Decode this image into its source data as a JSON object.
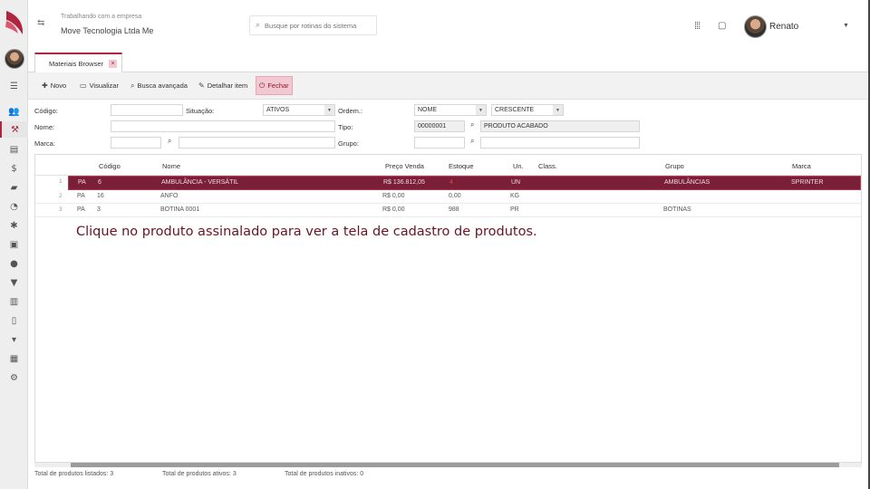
{
  "topbar": {
    "working_label": "Trabalhando com a empresa",
    "company_name": "Move Tecnologia Ltda Me",
    "search_placeholder": "Busque por rotinas do sistema",
    "user_name": "Renato"
  },
  "tabs": [
    {
      "label": "Materiais Browser",
      "close": "×"
    }
  ],
  "toolbar": {
    "novo": "Novo",
    "visualizar": "Visualizar",
    "busca_avancada": "Busca avançada",
    "detalhar_item": "Detalhar item",
    "fechar": "Fechar"
  },
  "filters": {
    "codigo_label": "Código:",
    "nome_label": "Nome:",
    "marca_label": "Marca:",
    "situacao_label": "Situação:",
    "situacao_value": "ATIVOS",
    "ordem_label": "Ordem.:",
    "ordem_value": "NOME",
    "direcao_value": "CRESCENTE",
    "tipo_label": "Tipo:",
    "tipo_code": "00000001",
    "tipo_desc": "PRODUTO ACABADO",
    "grupo_label": "Grupo:"
  },
  "grid": {
    "columns": [
      "Código",
      "Nome",
      "Preço Venda",
      "Estoque",
      "Un.",
      "Class.",
      "Grupo",
      "Marca"
    ],
    "rows": [
      {
        "num": "1",
        "tipo": "PA",
        "codigo": "6",
        "nome": "AMBULÂNCIA - VERSÁTIL",
        "preco": "R$ 136.812,05",
        "estoque": "4",
        "un": "UN",
        "classe": "",
        "grupo": "AMBULÂNCIAS",
        "marca": "SPRINTER"
      },
      {
        "num": "2",
        "tipo": "PA",
        "codigo": "16",
        "nome": "ANFO",
        "preco": "R$ 0,00",
        "estoque": "0,00",
        "un": "KG",
        "classe": "",
        "grupo": "",
        "marca": ""
      },
      {
        "num": "3",
        "tipo": "PA",
        "codigo": "3",
        "nome": "BOTINA 0001",
        "preco": "R$ 0,00",
        "estoque": "988",
        "un": "PR",
        "classe": "",
        "grupo": "BOTINAS",
        "marca": ""
      }
    ]
  },
  "annotation": "Clique no produto assinalado para ver a tela de cadastro de produtos.",
  "footer": {
    "listados": "Total de produtos listados:  3",
    "ativos": "Total de produtos ativos:  3",
    "inativos": "Total de produtos inativos:  0"
  },
  "colors": {
    "brand": "#b0243f",
    "selected_row": "#7a1f38"
  }
}
